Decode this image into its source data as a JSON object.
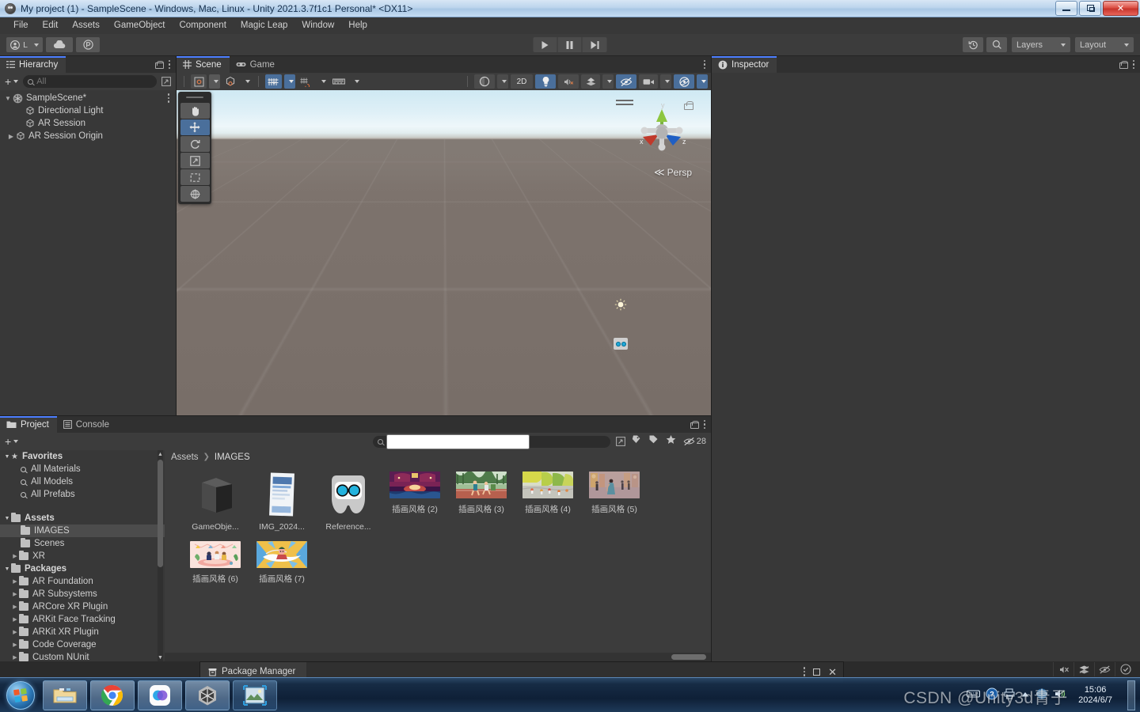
{
  "window": {
    "title": "My project (1) - SampleScene - Windows, Mac, Linux - Unity 2021.3.7f1c1 Personal* <DX11>",
    "minimize_label": "Minimize",
    "maximize_label": "Maximize",
    "close_label": "✕"
  },
  "menubar": {
    "items": [
      "File",
      "Edit",
      "Assets",
      "GameObject",
      "Component",
      "Magic Leap",
      "Window",
      "Help"
    ]
  },
  "toolbar": {
    "account_label": "L",
    "cloud_icon": "cloud-icon",
    "collab_icon": "collab-icon",
    "play_icon": "play-icon",
    "pause_icon": "pause-icon",
    "step_icon": "step-icon",
    "history_icon": "history-icon",
    "search_icon": "search-icon",
    "layers_label": "Layers",
    "layout_label": "Layout"
  },
  "hierarchy": {
    "tab_label": "Hierarchy",
    "search_placeholder": "All",
    "search_value": "",
    "add_label": "+",
    "items": [
      {
        "label": "SampleScene*",
        "depth": 0,
        "icon": "unity-scene-icon",
        "expanded": true,
        "selected": false,
        "has_arrow": true
      },
      {
        "label": "Directional Light",
        "depth": 1,
        "icon": "gameobject-icon",
        "expanded": false,
        "selected": false,
        "has_arrow": false
      },
      {
        "label": "AR Session",
        "depth": 1,
        "icon": "gameobject-icon",
        "expanded": false,
        "selected": false,
        "has_arrow": false
      },
      {
        "label": "AR Session Origin",
        "depth": 1,
        "icon": "gameobject-icon",
        "expanded": false,
        "selected": false,
        "has_arrow": true
      }
    ]
  },
  "scene": {
    "tabs": [
      {
        "label": "Scene",
        "icon": "scene-grid-icon",
        "active": true
      },
      {
        "label": "Game",
        "icon": "game-pad-icon",
        "active": false
      }
    ],
    "toolbar": {
      "pivot_label": "pivot-icon",
      "handle_label": "global-icon",
      "grid_snap_icon": "grid-snap-icon",
      "snap_increment_icon": "snap-increment-icon",
      "ruler_icon": "ruler-icon",
      "draw_mode_icon": "shaded-icon",
      "two_d_label": "2D",
      "light_icon": "light-icon",
      "audio_icon": "audio-mute-icon",
      "fx_icon": "effects-icon",
      "hidden_icon": "scene-visibility-icon",
      "camera_icon": "camera-icon",
      "gizmos_icon": "gizmos-icon"
    },
    "tools": [
      {
        "name": "hand-tool",
        "selected": false
      },
      {
        "name": "move-tool",
        "selected": true
      },
      {
        "name": "rotate-tool",
        "selected": false
      },
      {
        "name": "scale-tool",
        "selected": false
      },
      {
        "name": "rect-tool",
        "selected": false
      },
      {
        "name": "transform-tool",
        "selected": false
      }
    ],
    "gizmo": {
      "persp_label": "Persp",
      "axis_x": "x",
      "axis_y": "y",
      "axis_z": "z"
    }
  },
  "inspector": {
    "tab_label": "Inspector"
  },
  "project": {
    "tabs": [
      {
        "label": "Project",
        "icon": "folder-icon",
        "active": true
      },
      {
        "label": "Console",
        "icon": "console-icon",
        "active": false
      }
    ],
    "add_label": "+",
    "search_placeholder": "",
    "search_value": "",
    "hidden_count": "28",
    "breadcrumb": [
      "Assets",
      "IMAGES"
    ],
    "tree": [
      {
        "label": "Favorites",
        "depth": 0,
        "type": "favorites",
        "arrow": "open",
        "selected": false
      },
      {
        "label": "All Materials",
        "depth": 1,
        "type": "search",
        "arrow": "none",
        "selected": false
      },
      {
        "label": "All Models",
        "depth": 1,
        "type": "search",
        "arrow": "none",
        "selected": false
      },
      {
        "label": "All Prefabs",
        "depth": 1,
        "type": "search",
        "arrow": "none",
        "selected": false
      },
      {
        "label": "",
        "depth": 0,
        "type": "spacer",
        "arrow": "none",
        "selected": false
      },
      {
        "label": "Assets",
        "depth": 0,
        "type": "folder-open",
        "arrow": "open",
        "selected": false
      },
      {
        "label": "IMAGES",
        "depth": 1,
        "type": "folder",
        "arrow": "none",
        "selected": true
      },
      {
        "label": "Scenes",
        "depth": 1,
        "type": "folder",
        "arrow": "none",
        "selected": false
      },
      {
        "label": "XR",
        "depth": 1,
        "type": "folder",
        "arrow": "closed",
        "selected": false
      },
      {
        "label": "Packages",
        "depth": 0,
        "type": "folder-open",
        "arrow": "open",
        "selected": false
      },
      {
        "label": "AR Foundation",
        "depth": 1,
        "type": "folder",
        "arrow": "closed",
        "selected": false
      },
      {
        "label": "AR Subsystems",
        "depth": 1,
        "type": "folder",
        "arrow": "closed",
        "selected": false
      },
      {
        "label": "ARCore XR Plugin",
        "depth": 1,
        "type": "folder",
        "arrow": "closed",
        "selected": false
      },
      {
        "label": "ARKit Face Tracking",
        "depth": 1,
        "type": "folder",
        "arrow": "closed",
        "selected": false
      },
      {
        "label": "ARKit XR Plugin",
        "depth": 1,
        "type": "folder",
        "arrow": "closed",
        "selected": false
      },
      {
        "label": "Code Coverage",
        "depth": 1,
        "type": "folder",
        "arrow": "closed",
        "selected": false
      },
      {
        "label": "Custom NUnit",
        "depth": 1,
        "type": "folder",
        "arrow": "closed",
        "selected": false
      }
    ],
    "assets": [
      {
        "label": "GameObje...",
        "thumb": "cube-3d",
        "wide": false
      },
      {
        "label": "IMG_2024...",
        "thumb": "photo-document",
        "wide": false
      },
      {
        "label": "Reference...",
        "thumb": "goggles-icon",
        "wide": false
      },
      {
        "label": "插画风格 (2)",
        "thumb": "illustration-purple",
        "wide": true
      },
      {
        "label": "插画风格 (3)",
        "thumb": "illustration-runners",
        "wide": true
      },
      {
        "label": "插画风格 (4)",
        "thumb": "illustration-park",
        "wide": true
      },
      {
        "label": "插画风格 (5)",
        "thumb": "illustration-street",
        "wide": true
      },
      {
        "label": "插画风格 (6)",
        "thumb": "illustration-picnic",
        "wide": true
      },
      {
        "label": "插画风格 (7)",
        "thumb": "illustration-crane",
        "wide": true
      }
    ]
  },
  "package_manager": {
    "tab_label": "Package Manager",
    "kebab_label": "⋮",
    "maximize_label": "□",
    "close_label": "✕"
  },
  "status_bar": {
    "icons": [
      "mute-icon",
      "layers-status-icon",
      "visibility-status-icon",
      "check-circle-icon"
    ]
  },
  "taskbar": {
    "start_label": "Start",
    "items": [
      {
        "name": "explorer",
        "active": true
      },
      {
        "name": "chrome",
        "active": true
      },
      {
        "name": "app-purple",
        "active": true
      },
      {
        "name": "unity",
        "active": true
      },
      {
        "name": "photo-viewer",
        "active": false
      }
    ],
    "tray_icons": [
      "keyboard-icon",
      "help-icon",
      "printer-icon",
      "show-hidden-icon",
      "network-icon",
      "volume-icon"
    ],
    "clock_time": "15:06",
    "clock_date": "2024/6/7"
  },
  "watermark": {
    "text": "CSDN @Unity3d青子"
  },
  "colors": {
    "accent_blue": "#4a6f9b",
    "panel_bg": "#383838",
    "tab_bg": "#303030",
    "toolbar_bg": "#3c3c3c",
    "text": "#cfcfcf"
  }
}
